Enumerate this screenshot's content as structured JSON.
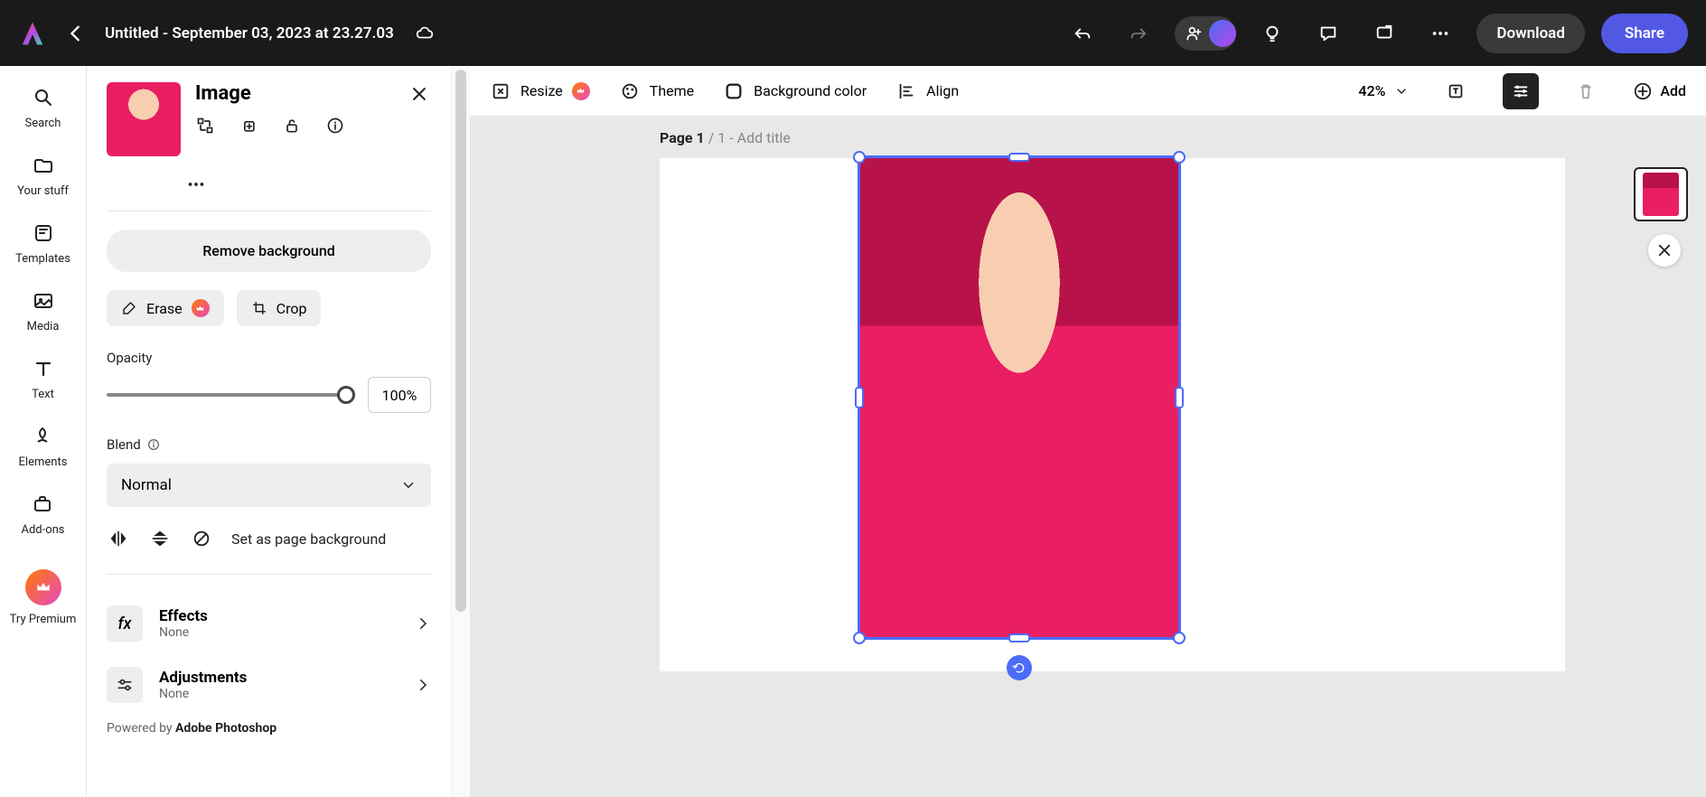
{
  "topbar": {
    "title": "Untitled - September 03, 2023 at 23.27.03",
    "download": "Download",
    "share": "Share"
  },
  "rail": {
    "search": "Search",
    "your_stuff": "Your stuff",
    "templates": "Templates",
    "media": "Media",
    "text": "Text",
    "elements": "Elements",
    "addons": "Add-ons",
    "try_premium": "Try Premium"
  },
  "panel": {
    "title": "Image",
    "remove_bg": "Remove background",
    "erase": "Erase",
    "crop": "Crop",
    "opacity_label": "Opacity",
    "opacity_value": "100%",
    "blend_label": "Blend",
    "blend_value": "Normal",
    "page_bg": "Set as page background",
    "effects_title": "Effects",
    "effects_sub": "None",
    "adjustments_title": "Adjustments",
    "adjustments_sub": "None",
    "powered_prefix": "Powered by ",
    "powered_brand": "Adobe Photoshop"
  },
  "context_bar": {
    "resize": "Resize",
    "theme": "Theme",
    "bg_color": "Background color",
    "align": "Align",
    "zoom": "42%",
    "add": "Add"
  },
  "stage": {
    "page_label_prefix": "Page 1",
    "page_label_of": " / 1 - ",
    "add_title": "Add title"
  }
}
